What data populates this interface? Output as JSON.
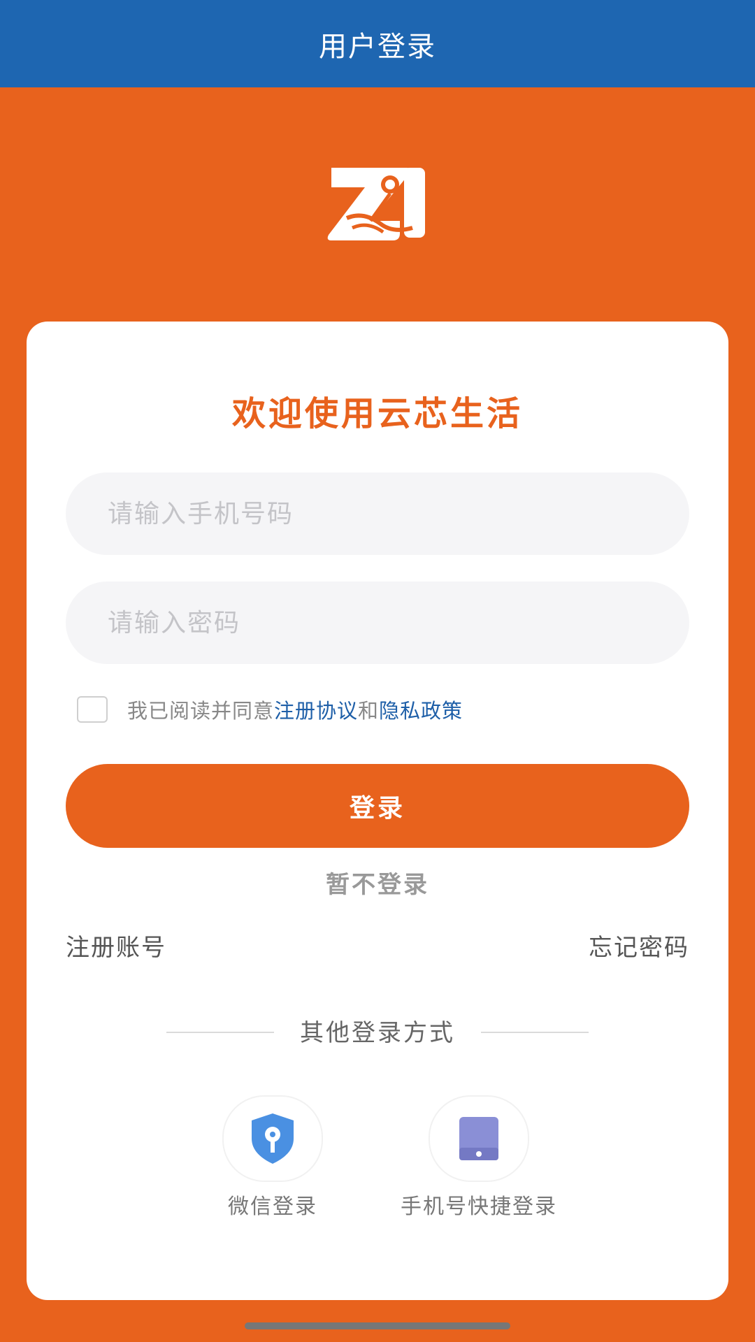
{
  "colors": {
    "header": "#1E66B1",
    "background": "#E8621D",
    "accent": "#E8621D",
    "link": "#1E5FA8"
  },
  "header": {
    "title": "用户登录"
  },
  "logo": {
    "icon": "zz-logo-icon"
  },
  "card": {
    "welcome": "欢迎使用云芯生活",
    "phone_input": {
      "placeholder": "请输入手机号码",
      "value": ""
    },
    "password_input": {
      "placeholder": "请输入密码",
      "value": ""
    },
    "agreement": {
      "checked": false,
      "prefix": "我已阅读并同意",
      "register_link": "注册协议",
      "and": "和",
      "privacy_link": "隐私政策"
    },
    "login_button": "登录",
    "skip_login": "暂不登录",
    "register_account": "注册账号",
    "forgot_password": "忘记密码",
    "other_methods_title": "其他登录方式",
    "methods": [
      {
        "label": "微信登录",
        "icon": "shield-key-icon"
      },
      {
        "label": "手机号快捷登录",
        "icon": "tablet-icon"
      }
    ]
  }
}
